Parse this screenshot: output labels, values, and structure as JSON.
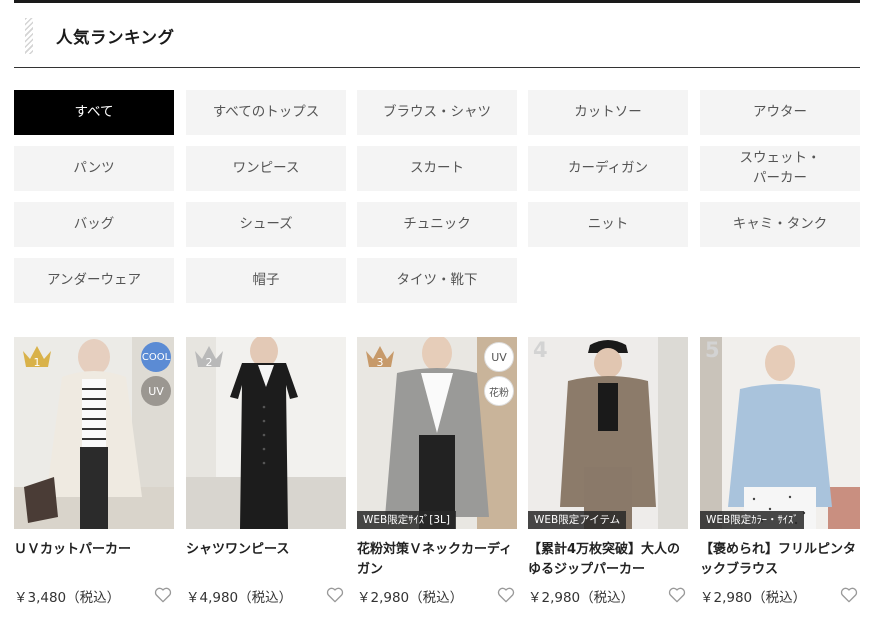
{
  "section": {
    "title": "人気ランキング"
  },
  "categories": [
    "すべて",
    "すべてのトップス",
    "ブラウス・シャツ",
    "カットソー",
    "アウター",
    "パンツ",
    "ワンピース",
    "スカート",
    "カーディガン",
    "スウェット・\nパーカー",
    "バッグ",
    "シューズ",
    "チュニック",
    "ニット",
    "キャミ・タンク",
    "アンダーウェア",
    "帽子",
    "タイツ・靴下"
  ],
  "active_category": "すべて",
  "products": [
    {
      "rank": "1",
      "name": "ＵＶカットパーカー",
      "price": "￥3,480（税込）",
      "badges": [
        "COOL",
        "UV"
      ],
      "ribbon": "",
      "crown_color": "#d9b24a"
    },
    {
      "rank": "2",
      "name": "シャツワンピース",
      "price": "￥4,980（税込）",
      "badges": [],
      "ribbon": "",
      "crown_color": "#b9b9b9"
    },
    {
      "rank": "3",
      "name": "花粉対策Ｖネックカーディガン",
      "price": "￥2,980（税込）",
      "badges": [
        "UV",
        "花粉"
      ],
      "ribbon": "WEB限定ｻｲｽﾞ[3L]",
      "crown_color": "#c79a6a"
    },
    {
      "rank": "4",
      "name": "【累計4万枚突破】大人のゆるジップパーカー",
      "price": "￥2,980（税込）",
      "badges": [],
      "ribbon": "WEB限定アイテム"
    },
    {
      "rank": "5",
      "name": "【褒められ】フリルピンタックブラウス",
      "price": "￥2,980（税込）",
      "badges": [],
      "ribbon": "WEB限定ｶﾗｰ・ｻｲｽﾞ"
    }
  ],
  "colors": {
    "active_bg": "#000000",
    "button_bg": "#f4f4f4",
    "cool_badge": "#5b8bd4"
  },
  "icons": {
    "favorite": "heart-outline-icon",
    "rank_top3": "crown-icon"
  }
}
